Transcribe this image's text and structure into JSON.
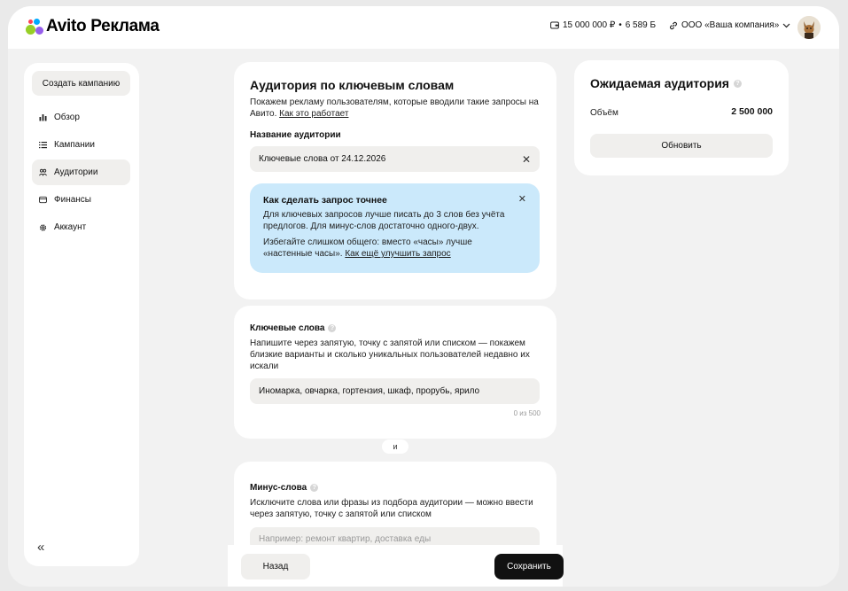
{
  "header": {
    "brand": "Avito Реклама",
    "balance": "15 000 000 ₽",
    "bonus": "6 589 Б",
    "separator": "•",
    "company": "ООО «Ваша компания»"
  },
  "sidebar": {
    "create_label": "Создать кампанию",
    "items": [
      {
        "label": "Обзор",
        "icon": "bar-chart-icon"
      },
      {
        "label": "Кампании",
        "icon": "list-icon"
      },
      {
        "label": "Аудитории",
        "icon": "people-icon",
        "active": true
      },
      {
        "label": "Финансы",
        "icon": "wallet-icon"
      },
      {
        "label": "Аккаунт",
        "icon": "gear-icon"
      }
    ],
    "collapse_label": "«"
  },
  "audience": {
    "title": "Аудитория по ключевым словам",
    "desc": "Покажем рекламу пользователям, которые вводили такие запросы на Авито.",
    "desc_link": "Как это работает",
    "name_label": "Название аудитории",
    "name_value": "Ключевые слова от 24.12.2026"
  },
  "tip": {
    "title": "Как сделать запрос точнее",
    "text1": "Для ключевых запросов лучше писать до 3 слов без учёта предлогов. Для минус-слов достаточно одного-двух.",
    "text2": "Избегайте слишком общего: вместо «часы» лучше «настенные часы».",
    "link": "Как ещё улучшить запрос"
  },
  "keywords": {
    "title": "Ключевые слова",
    "desc": "Напишите через запятую, точку с запятой или списком — покажем близкие варианты и сколько уникальных пользователей недавно их искали",
    "value": "Иномарка, овчарка, гортензия, шкаф, прорубь, ярило",
    "counter": "0 из 500"
  },
  "and_label": "и",
  "minus": {
    "title": "Минус-слова",
    "desc": "Исключите слова или фразы из подбора аудитории — можно ввести через запятую, точку с запятой или списком",
    "placeholder": "Например: ремонт квартир, доставка еды"
  },
  "expected": {
    "title": "Ожидаемая аудитория",
    "volume_label": "Объём",
    "volume_value": "2 500 000",
    "refresh_label": "Обновить"
  },
  "footer": {
    "back_label": "Назад",
    "save_label": "Сохранить"
  },
  "colors": {
    "tip_bg": "#cbe9fb",
    "primary_btn": "#111111",
    "logo_dots": [
      "#97cf26",
      "#0af",
      "#ff4053",
      "#965eeb"
    ]
  }
}
